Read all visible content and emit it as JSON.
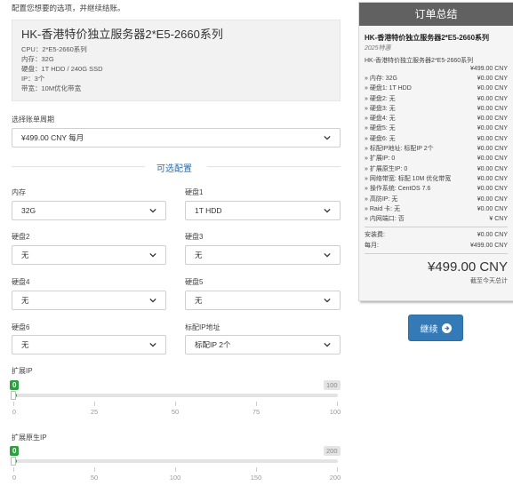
{
  "intro_text": "配置您想要的选项，并继续结账。",
  "product": {
    "title": "HK-香港特价独立服务器2*E5-2660系列",
    "specs": [
      "CPU：2*E5-2660系列",
      "内存：32G",
      "硬盘：1T HDD / 240G SSD",
      "IP：3个",
      "带宽：10M优化带宽"
    ]
  },
  "billing": {
    "label": "选择账单周期",
    "value": "¥499.00 CNY 每月"
  },
  "section_title": "可选配置",
  "options": [
    {
      "label": "内存",
      "value": "32G"
    },
    {
      "label": "硬盘1",
      "value": "1T HDD"
    },
    {
      "label": "硬盘2",
      "value": "无"
    },
    {
      "label": "硬盘3",
      "value": "无"
    },
    {
      "label": "硬盘4",
      "value": "无"
    },
    {
      "label": "硬盘5",
      "value": "无"
    },
    {
      "label": "硬盘6",
      "value": "无"
    },
    {
      "label": "标配IP地址",
      "value": "标配IP 2个"
    }
  ],
  "sliders": [
    {
      "label": "扩展IP",
      "current": "0",
      "max_label": "100",
      "ticks": [
        "0",
        "25",
        "50",
        "75",
        "100"
      ]
    },
    {
      "label": "扩展原生IP",
      "current": "0",
      "max_label": "200",
      "ticks": [
        "0",
        "50",
        "100",
        "150",
        "200"
      ]
    }
  ],
  "summary": {
    "title": "订单总结",
    "product_name": "HK-香港特价独立服务器2*E5-2660系列",
    "group": "2025特惠",
    "base_name": "HK-香港特价独立服务器2*E5-2660系列",
    "base_price": "¥499.00 CNY",
    "lines": [
      {
        "label": "» 内存: 32G",
        "price": "¥0.00 CNY"
      },
      {
        "label": "» 硬盘1: 1T HDD",
        "price": "¥0.00 CNY"
      },
      {
        "label": "» 硬盘2: 无",
        "price": "¥0.00 CNY"
      },
      {
        "label": "» 硬盘3: 无",
        "price": "¥0.00 CNY"
      },
      {
        "label": "» 硬盘4: 无",
        "price": "¥0.00 CNY"
      },
      {
        "label": "» 硬盘5: 无",
        "price": "¥0.00 CNY"
      },
      {
        "label": "» 硬盘6: 无",
        "price": "¥0.00 CNY"
      },
      {
        "label": "» 标配IP地址: 标配IP 2个",
        "price": "¥0.00 CNY"
      },
      {
        "label": "» 扩展IP: 0",
        "price": "¥0.00 CNY"
      },
      {
        "label": "» 扩展原生IP: 0",
        "price": "¥0.00 CNY"
      },
      {
        "label": "» 网络带宽: 标配 10M 优化带宽",
        "price": "¥0.00 CNY"
      },
      {
        "label": "» 操作系统: CentOS 7.6",
        "price": "¥0.00 CNY"
      },
      {
        "label": "» 高防IP: 无",
        "price": "¥0.00 CNY"
      },
      {
        "label": "» Raid 卡: 无",
        "price": "¥0.00 CNY"
      },
      {
        "label": "» 内网端口: 否",
        "price": "¥ CNY"
      }
    ],
    "setup_label": "安装费:",
    "setup_price": "¥0.00 CNY",
    "monthly_label": "每月:",
    "monthly_price": "¥499.00 CNY",
    "total": "¥499.00 CNY",
    "due_today": "截至今天总计"
  },
  "continue_label": "继续"
}
